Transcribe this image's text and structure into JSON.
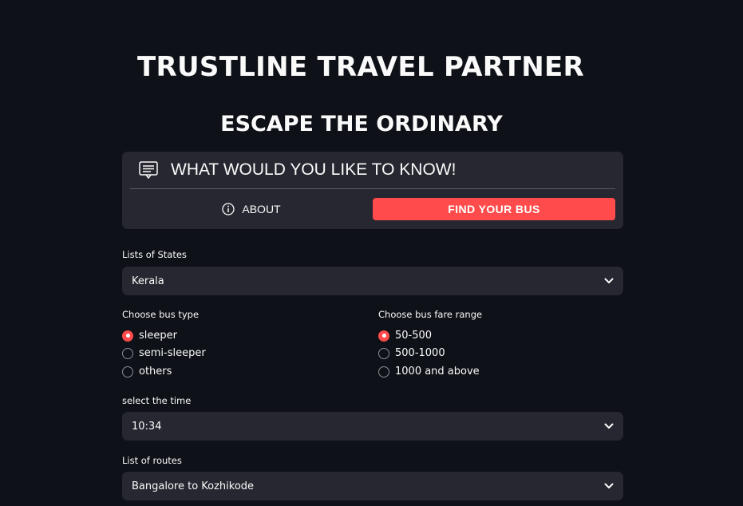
{
  "header": {
    "title": "TRUSTLINE TRAVEL PARTNER",
    "subtitle": "ESCAPE THE ORDINARY"
  },
  "menu": {
    "title": "WHAT WOULD YOU LIKE TO KNOW!",
    "icon": "card-text-icon",
    "items": [
      {
        "label": "ABOUT",
        "icon": "info-circle-icon",
        "selected": false
      },
      {
        "label": "FIND YOUR BUS",
        "selected": true
      }
    ]
  },
  "states": {
    "label": "Lists of States",
    "value": "Kerala"
  },
  "bus_type": {
    "label": "Choose bus type",
    "options": [
      "sleeper",
      "semi-sleeper",
      "others"
    ],
    "selected": "sleeper"
  },
  "fare_range": {
    "label": "Choose bus fare range",
    "options": [
      "50-500",
      "500-1000",
      "1000 and above"
    ],
    "selected": "50-500"
  },
  "time": {
    "label": "select the time",
    "value": "10:34"
  },
  "routes": {
    "label": "List of routes",
    "value": "Bangalore to Kozhikode"
  },
  "colors": {
    "background": "#0e1117",
    "accent": "#ff4b4b",
    "widget": "#262730"
  }
}
